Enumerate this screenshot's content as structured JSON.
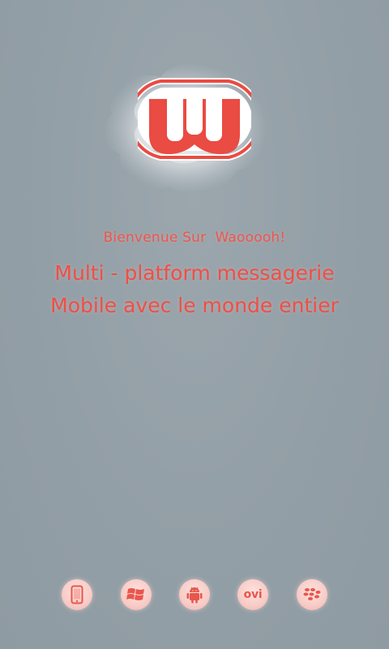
{
  "app": {
    "logo_letter": "W"
  },
  "welcome": {
    "text": "Bienvenue Sur  Waooooh!"
  },
  "tagline": {
    "line1": "Multi - platform messagerie",
    "line2": "Mobile avec le monde entier"
  },
  "platforms": [
    {
      "name": "phone-icon"
    },
    {
      "name": "windows-icon"
    },
    {
      "name": "android-icon"
    },
    {
      "name": "ovi-icon",
      "label": "ovi"
    },
    {
      "name": "blackberry-icon"
    }
  ],
  "colors": {
    "background": "#939fa6",
    "accent": "#ef4f46",
    "icon_bg": "#f8cbc6"
  }
}
